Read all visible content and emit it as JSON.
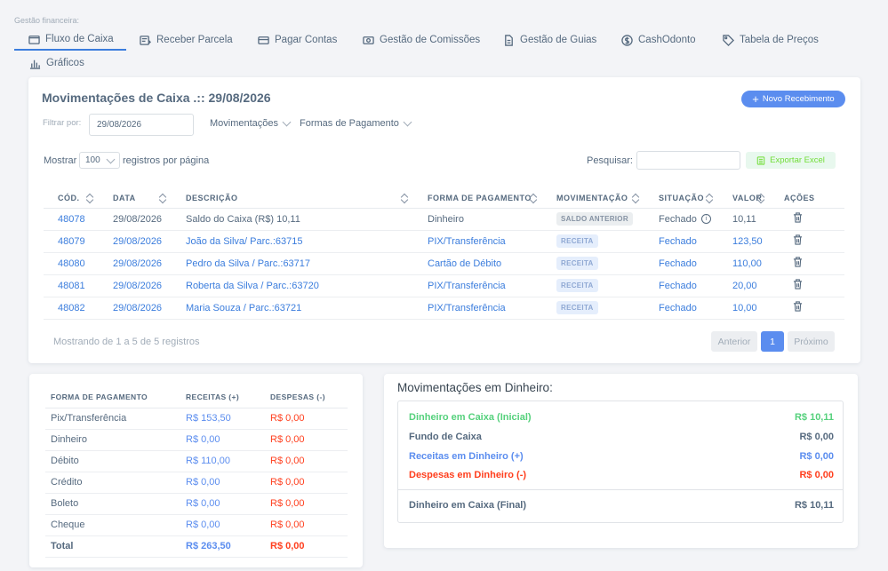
{
  "section_label": "Gestão financeira:",
  "tabs": [
    {
      "label": "Fluxo de Caixa",
      "icon": "wallet-icon"
    },
    {
      "label": "Receber Parcela",
      "icon": "receipt-icon"
    },
    {
      "label": "Pagar Contas",
      "icon": "credit-card-icon"
    },
    {
      "label": "Gestão de Comissões",
      "icon": "cash-icon"
    },
    {
      "label": "Gestão de Guias",
      "icon": "document-icon"
    },
    {
      "label": "CashOdonto",
      "icon": "dollar-circle-icon"
    },
    {
      "label": "Tabela de Preços",
      "icon": "price-tag-icon"
    },
    {
      "label": "Gráficos",
      "icon": "bar-chart-icon"
    }
  ],
  "main": {
    "title": "Movimentações de Caixa .:: 29/08/2026",
    "new_button": "Novo Recebimento",
    "filter_label": "Filtrar por:",
    "filter_date": "29/08/2026",
    "dropdown_mov": "Movimentações",
    "dropdown_forms": "Formas de Pagamento",
    "show_label": "Mostrar",
    "page_size": "100",
    "per_page_label": "registros por página",
    "search_label": "Pesquisar:",
    "search_value": "",
    "export_button": "Exportar Excel",
    "columns": [
      "CÓD.",
      "DATA",
      "DESCRIÇÃO",
      "FORMA DE PAGAMENTO",
      "MOVIMENTAÇÃO",
      "SITUAÇÃO",
      "VALOR",
      "AÇÕES"
    ],
    "rows": [
      {
        "code": "48078",
        "date": "29/08/2026",
        "desc": "Saldo do Caixa (R$) 10,11",
        "payment": "Dinheiro",
        "movement": "SALDO ANTERIOR",
        "status": "Fechado",
        "value": "10,11"
      },
      {
        "code": "48079",
        "date": "29/08/2026",
        "desc": "João da Silva/ Parc.:63715",
        "payment": "PIX/Transferência",
        "movement": "RECEITA",
        "status": "Fechado",
        "value": "123,50"
      },
      {
        "code": "48080",
        "date": "29/08/2026",
        "desc": "Pedro da Silva / Parc.:63717",
        "payment": "Cartão de Débito",
        "movement": "RECEITA",
        "status": "Fechado",
        "value": "110,00"
      },
      {
        "code": "48081",
        "date": "29/08/2026",
        "desc": "Roberta da Silva / Parc.:63720",
        "payment": "PIX/Transferência",
        "movement": "RECEITA",
        "status": "Fechado",
        "value": "20,00"
      },
      {
        "code": "48082",
        "date": "29/08/2026",
        "desc": "Maria Souza / Parc.:63721",
        "payment": "PIX/Transferência",
        "movement": "RECEITA",
        "status": "Fechado",
        "value": "10,00"
      }
    ],
    "footer_info": "Mostrando de 1 a 5 de 5 registros",
    "pagination": {
      "prev": "Anterior",
      "current": "1",
      "next": "Próximo"
    }
  },
  "summary": {
    "columns": [
      "FORMA DE PAGAMENTO",
      "RECEITAS (+)",
      "DESPESAS (-)"
    ],
    "rows": [
      {
        "form": "Pix/Transferência",
        "rec": "R$ 153,50",
        "desp": "R$ 0,00"
      },
      {
        "form": "Dinheiro",
        "rec": "R$ 0,00",
        "desp": "R$ 0,00"
      },
      {
        "form": "Débito",
        "rec": "R$ 110,00",
        "desp": "R$ 0,00"
      },
      {
        "form": "Crédito",
        "rec": "R$ 0,00",
        "desp": "R$ 0,00"
      },
      {
        "form": "Boleto",
        "rec": "R$ 0,00",
        "desp": "R$ 0,00"
      },
      {
        "form": "Cheque",
        "rec": "R$ 0,00",
        "desp": "R$ 0,00"
      }
    ],
    "total": {
      "label": "Total",
      "rec": "R$ 263,50",
      "desp": "R$ 0,00"
    }
  },
  "cash": {
    "title": "Movimentações em Dinheiro:",
    "lines": [
      {
        "label": "Dinheiro em Caixa (Inicial)",
        "value": "R$ 10,11"
      },
      {
        "label": "Fundo de Caixa",
        "value": "R$ 0,00"
      },
      {
        "label": "Receitas em Dinheiro (+)",
        "value": "R$ 0,00"
      },
      {
        "label": "Despesas em Dinheiro (-)",
        "value": "R$ 0,00"
      },
      {
        "label": "Dinheiro em Caixa (Final)",
        "value": "R$ 10,11"
      }
    ]
  },
  "colors": {
    "primary": "#5b8def",
    "green": "#55d17c",
    "red": "#ff3e1d",
    "text": "#566a7f"
  }
}
